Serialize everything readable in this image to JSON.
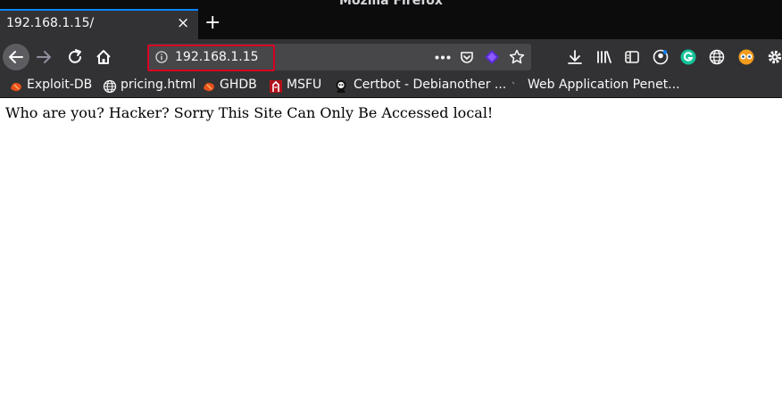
{
  "window": {
    "title": "Mozilla Firefox"
  },
  "tab": {
    "title": "192.168.1.15/",
    "close_label": "×",
    "new_tab_label": "+"
  },
  "urlbar": {
    "url": "192.168.1.15"
  },
  "bookmarks": [
    {
      "label": "Exploit-DB",
      "icon": "exploit-db-icon"
    },
    {
      "label": "pricing.html",
      "icon": "globe-icon"
    },
    {
      "label": "GHDB",
      "icon": "ghdb-icon"
    },
    {
      "label": "MSFU",
      "icon": "msfu-icon"
    },
    {
      "label": "Certbot - Debianother ...",
      "icon": "certbot-icon"
    },
    {
      "label": "Web Application Penet...",
      "icon": "bookmark-icon"
    }
  ],
  "page": {
    "message": "Who are you? Hacker? Sorry This Site Can Only Be Accessed local!"
  },
  "colors": {
    "accent": "#0a84ff",
    "highlight": "#d70022",
    "toolbar": "#323234",
    "titlebar": "#0c0c0d"
  }
}
